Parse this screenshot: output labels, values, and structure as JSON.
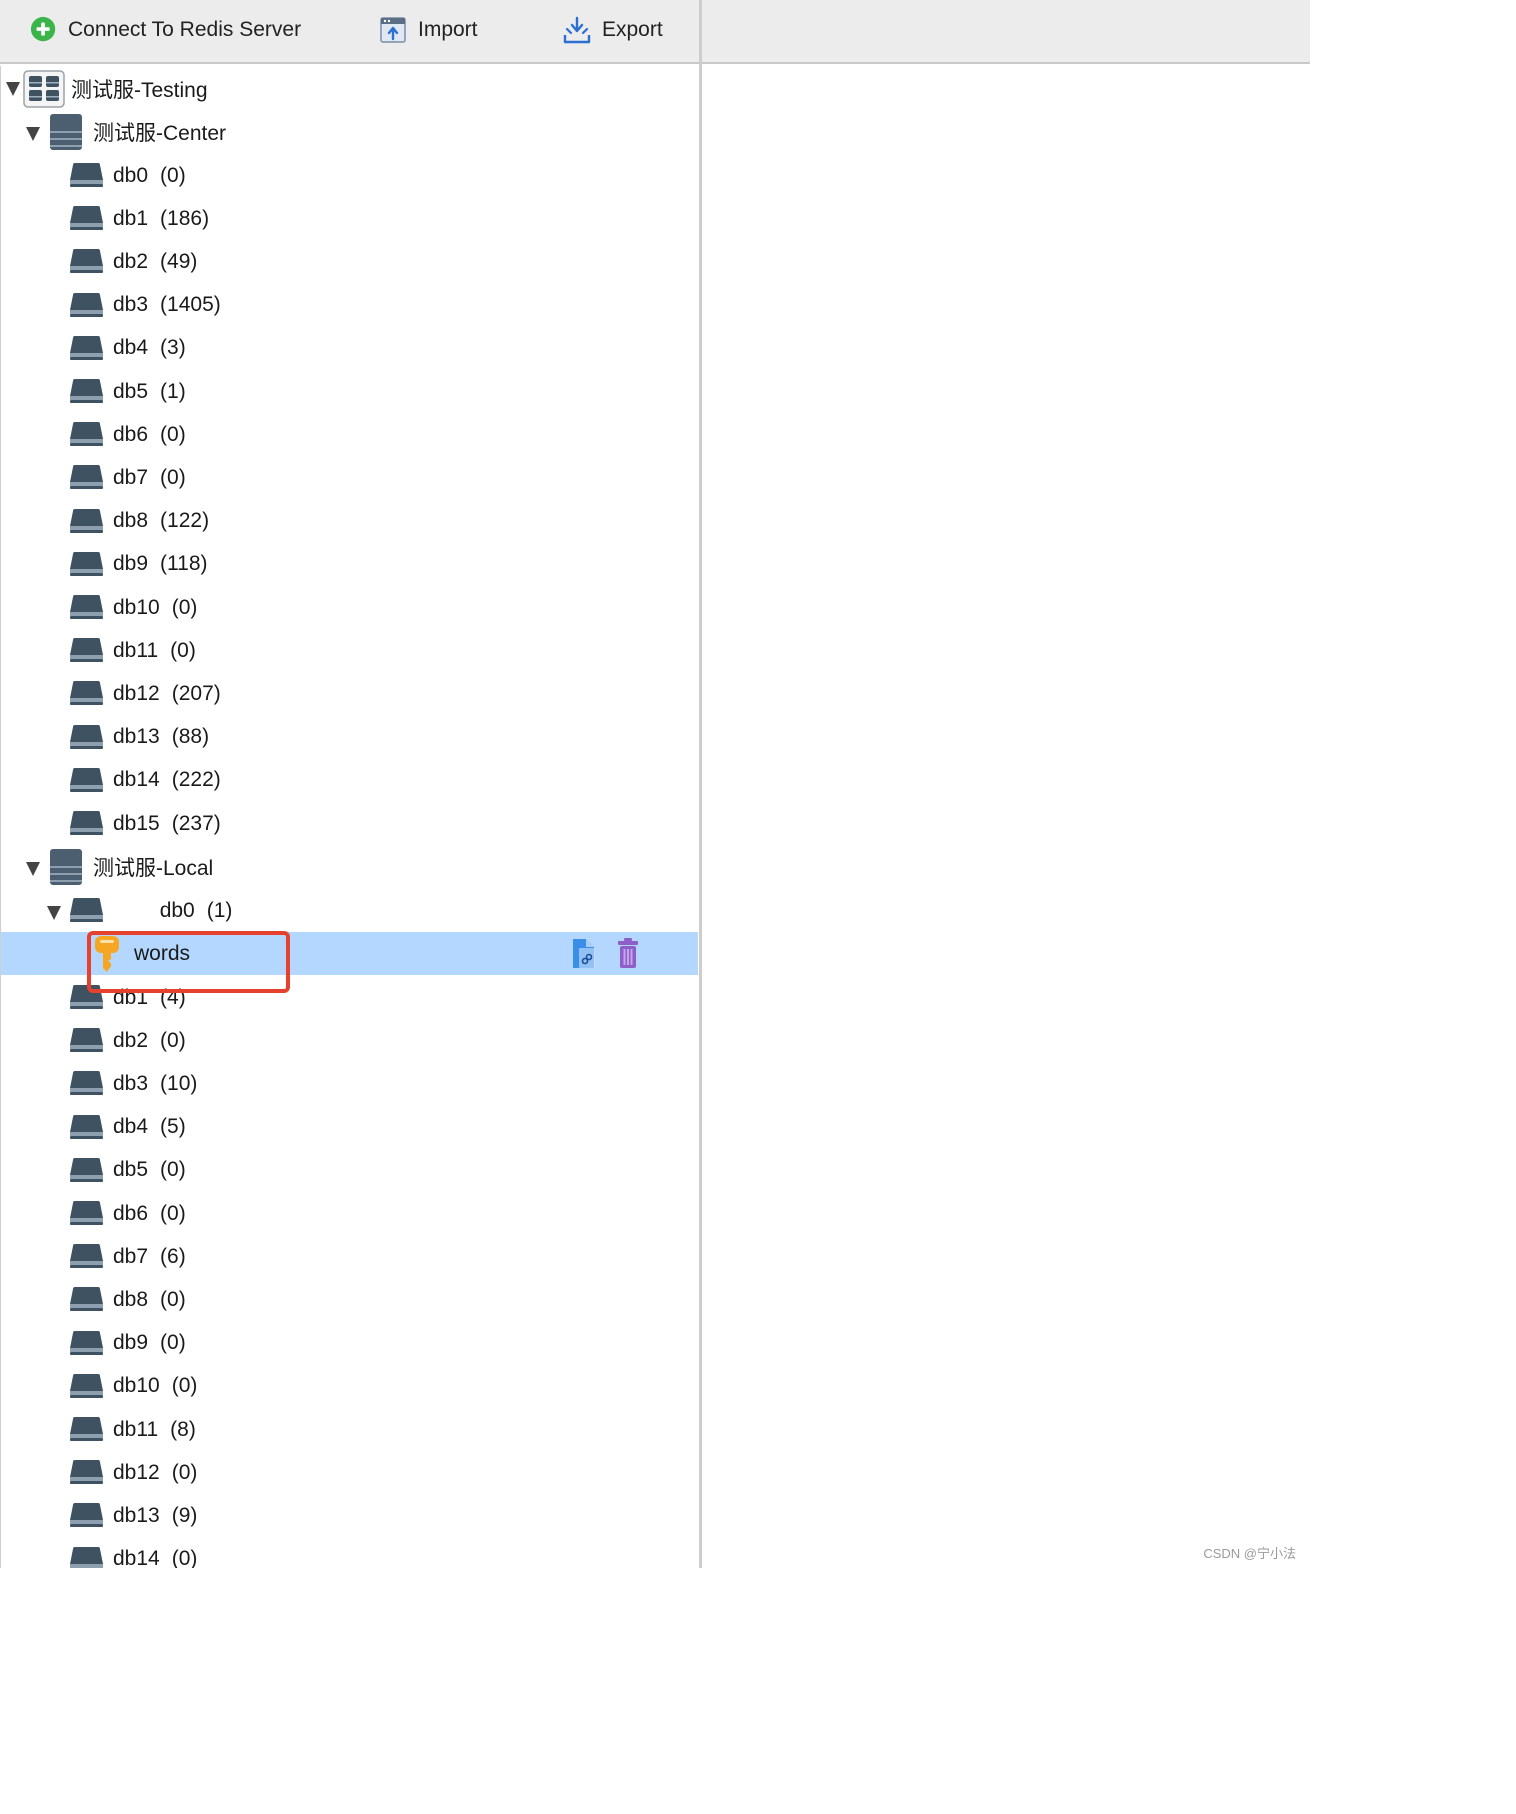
{
  "toolbar": {
    "connect_label": "Connect To Redis Server",
    "import_label": "Import",
    "export_label": "Export"
  },
  "tree": {
    "cluster": {
      "name": "测试服-Testing",
      "servers": [
        {
          "name": "测试服-Center",
          "dbs": [
            {
              "name": "db0",
              "count": "(0)"
            },
            {
              "name": "db1",
              "count": "(186)"
            },
            {
              "name": "db2",
              "count": "(49)"
            },
            {
              "name": "db3",
              "count": "(1405)"
            },
            {
              "name": "db4",
              "count": "(3)"
            },
            {
              "name": "db5",
              "count": "(1)"
            },
            {
              "name": "db6",
              "count": "(0)"
            },
            {
              "name": "db7",
              "count": "(0)"
            },
            {
              "name": "db8",
              "count": "(122)"
            },
            {
              "name": "db9",
              "count": "(118)"
            },
            {
              "name": "db10",
              "count": "(0)"
            },
            {
              "name": "db11",
              "count": "(0)"
            },
            {
              "name": "db12",
              "count": "(207)"
            },
            {
              "name": "db13",
              "count": "(88)"
            },
            {
              "name": "db14",
              "count": "(222)"
            },
            {
              "name": "db15",
              "count": "(237)"
            }
          ]
        },
        {
          "name": "测试服-Local",
          "expanded_db": {
            "name": "db0",
            "count": "(1)",
            "key": "words"
          },
          "dbs": [
            {
              "name": "db1",
              "count": "(4)"
            },
            {
              "name": "db2",
              "count": "(0)"
            },
            {
              "name": "db3",
              "count": "(10)"
            },
            {
              "name": "db4",
              "count": "(5)"
            },
            {
              "name": "db5",
              "count": "(0)"
            },
            {
              "name": "db6",
              "count": "(0)"
            },
            {
              "name": "db7",
              "count": "(6)"
            },
            {
              "name": "db8",
              "count": "(0)"
            },
            {
              "name": "db9",
              "count": "(0)"
            },
            {
              "name": "db10",
              "count": "(0)"
            },
            {
              "name": "db11",
              "count": "(8)"
            },
            {
              "name": "db12",
              "count": "(0)"
            },
            {
              "name": "db13",
              "count": "(9)"
            },
            {
              "name": "db14",
              "count": "(0)"
            }
          ]
        }
      ]
    }
  },
  "colors": {
    "selection": "#b3d7ff",
    "highlight_box": "#e5412e",
    "db_icon": "#3f5262",
    "key_icon": "#f5a623",
    "delete_icon": "#8e5fc8"
  },
  "watermark": "CSDN @宁小法"
}
